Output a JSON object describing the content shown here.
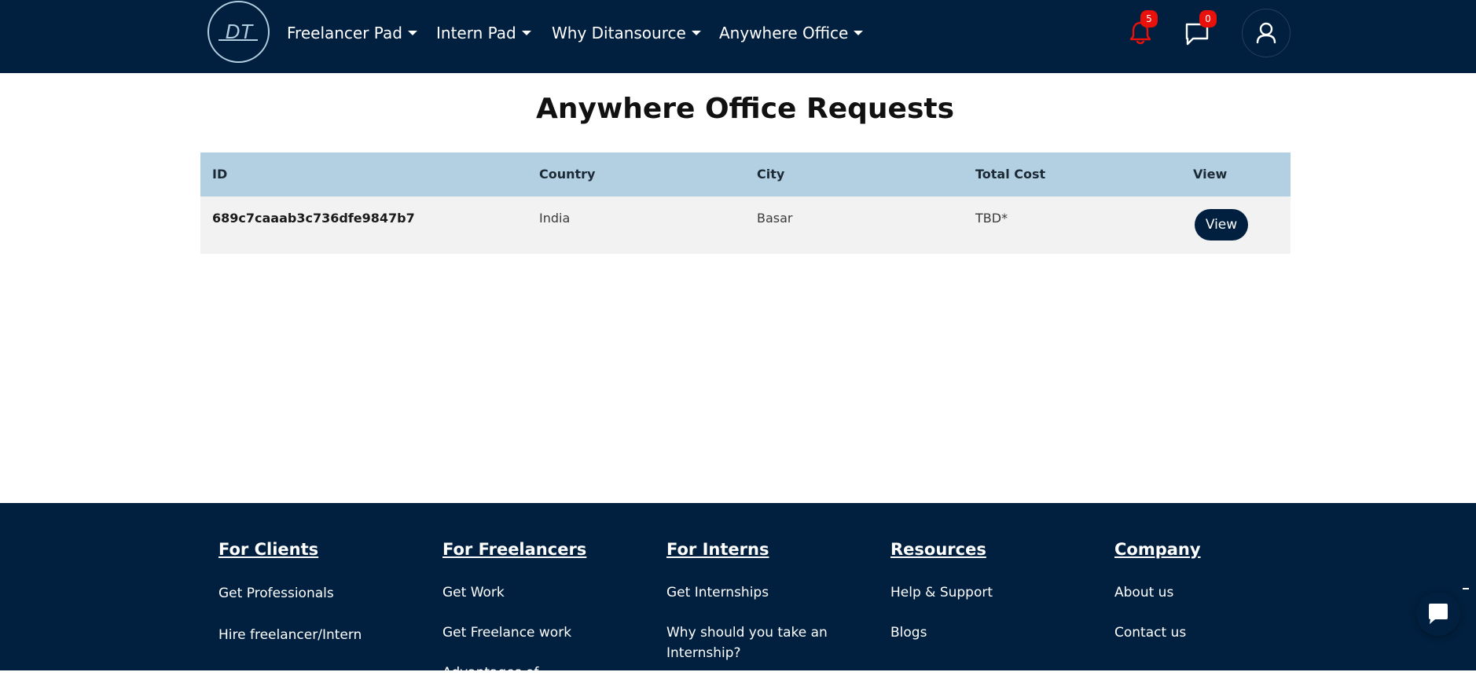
{
  "nav": {
    "logo_text": "DT",
    "items": [
      {
        "label": "Freelancer Pad"
      },
      {
        "label": "Intern Pad"
      },
      {
        "label": "Why Ditansource"
      },
      {
        "label": "Anywhere Office"
      }
    ],
    "notification_count": "5",
    "message_count": "0"
  },
  "main": {
    "title": "Anywhere Office Requests",
    "columns": [
      "ID",
      "Country",
      "City",
      "Total Cost",
      "View"
    ],
    "rows": [
      {
        "id": "689c7caaab3c736dfe9847b7",
        "country": "India",
        "city": "Basar",
        "total_cost": "TBD*",
        "view_label": "View"
      }
    ]
  },
  "footer": {
    "columns": [
      {
        "heading": "For Clients",
        "links": [
          "Get Professionals",
          "Hire freelancer/Intern"
        ]
      },
      {
        "heading": "For Freelancers",
        "links": [
          "Get Work",
          "Get Freelance work",
          "Advantages of"
        ]
      },
      {
        "heading": "For Interns",
        "links": [
          "Get Internships",
          "Why should you take an Internship?"
        ]
      },
      {
        "heading": "Resources",
        "links": [
          "Help & Support",
          "Blogs"
        ]
      },
      {
        "heading": "Company",
        "links": [
          "About us",
          "Contact us"
        ]
      }
    ]
  },
  "colors": {
    "brand_navy": "#01203f",
    "table_header": "#b3cfe2",
    "badge_red": "#e8110c"
  }
}
